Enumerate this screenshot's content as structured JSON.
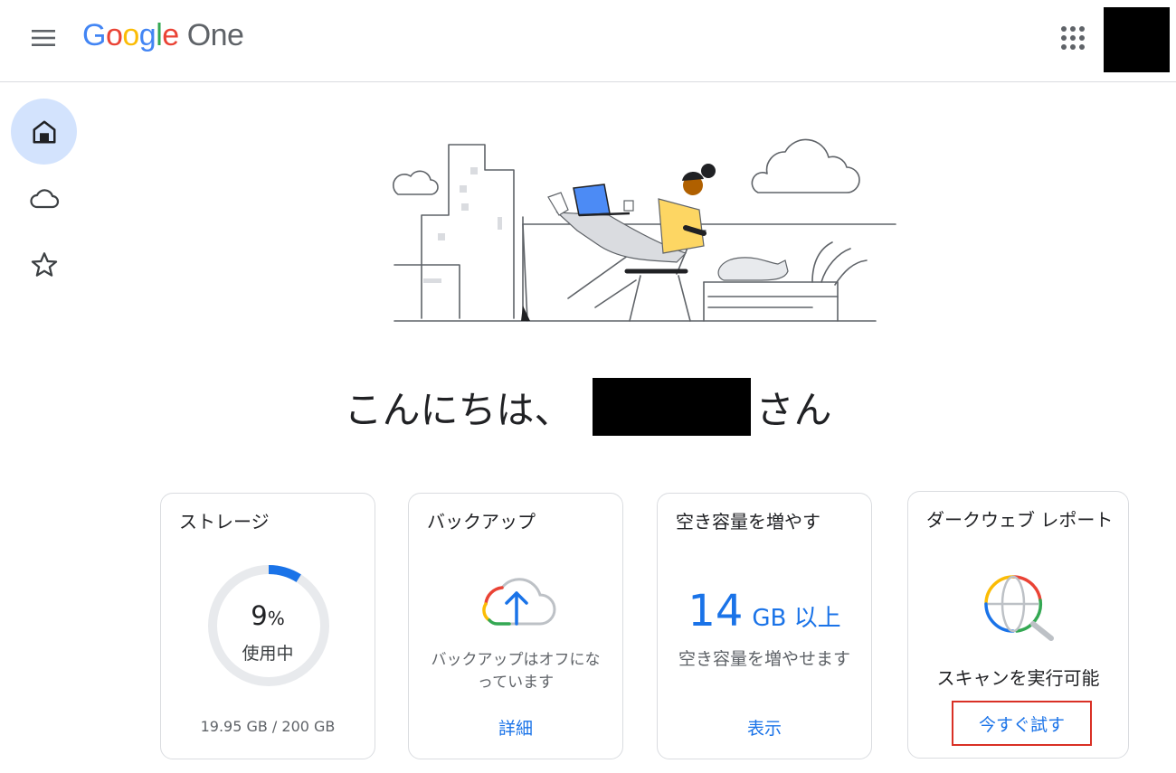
{
  "header": {
    "menu_icon": "menu-icon",
    "logo_google": [
      "G",
      "o",
      "o",
      "g",
      "l",
      "e"
    ],
    "logo_colors": [
      "#4285F4",
      "#EA4335",
      "#FBBC05",
      "#4285F4",
      "#34A853",
      "#EA4335"
    ],
    "product_name": "One",
    "apps_icon": "apps-grid-icon",
    "avatar": "account-avatar (redacted)"
  },
  "sidebar": {
    "items": [
      {
        "icon": "home-icon",
        "active": true
      },
      {
        "icon": "cloud-icon",
        "active": false
      },
      {
        "icon": "star-icon",
        "active": false
      }
    ]
  },
  "greeting": {
    "prefix": "こんにちは、",
    "suffix": "さん"
  },
  "cards": {
    "storage": {
      "title": "ストレージ",
      "percent": "9",
      "percent_sign": "%",
      "percent_value": 9,
      "used_label": "使用中",
      "detail": "19.95 GB / 200 GB"
    },
    "backup": {
      "title": "バックアップ",
      "status_line1": "バックアップはオフにな",
      "status_line2": "っています",
      "link": "詳細"
    },
    "free_space": {
      "title": "空き容量を増やす",
      "amount": "14",
      "unit": "GB 以上",
      "description": "空き容量を増やせます",
      "link": "表示"
    },
    "dark_web": {
      "title": "ダークウェブ レポート",
      "status": "スキャンを実行可能",
      "button": "今すぐ試す"
    }
  },
  "colors": {
    "accent": "#1a73e8",
    "active_nav_bg": "#d3e3fd",
    "highlight_border": "#d93025"
  }
}
